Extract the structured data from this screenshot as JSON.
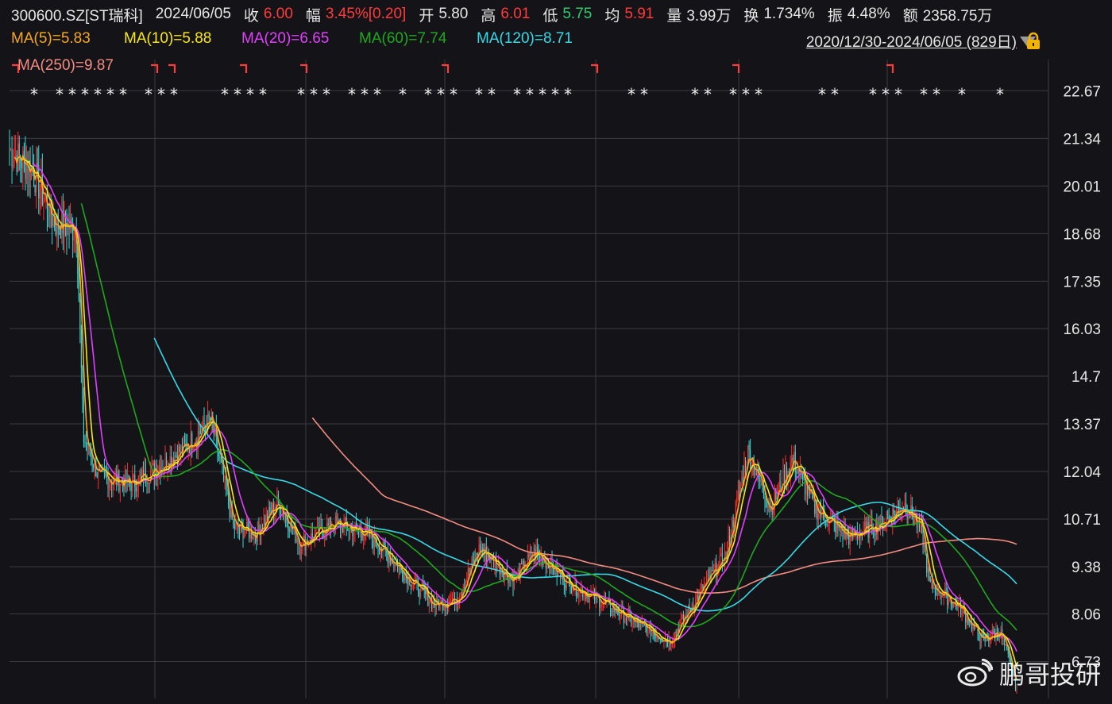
{
  "header": {
    "code": "300600.SZ[ST瑞科]",
    "date": "2024/06/05",
    "close_label": "收",
    "close_value": "6.00",
    "change_label": "幅",
    "change_value": "3.45%[0.20]",
    "open_label": "开",
    "open_value": "5.80",
    "high_label": "高",
    "high_value": "6.01",
    "low_label": "低",
    "low_value": "5.75",
    "avg_label": "均",
    "avg_value": "5.91",
    "volume_label": "量",
    "volume_value": "3.99万",
    "turnover_label": "换",
    "turnover_value": "1.734%",
    "amplitude_label": "振",
    "amplitude_value": "4.48%",
    "amount_label": "额",
    "amount_value": "2358.75万"
  },
  "ma_legend": {
    "ma5": "MA(5)=5.83",
    "ma10": "MA(10)=5.88",
    "ma20": "MA(20)=6.65",
    "ma60": "MA(60)=7.74",
    "ma120": "MA(120)=8.71",
    "ma250": "MA(250)=9.87",
    "range": "2020/12/30-2024/06/05 (829日)"
  },
  "colors": {
    "ma5": "#f5a623",
    "ma10": "#f8e71c",
    "ma20": "#e040fb",
    "ma60": "#1fa81f",
    "ma120": "#38d9e8",
    "ma250": "#f28b82",
    "up": "#ff2e2e",
    "down": "#3ad6d6",
    "grid": "#3a3a40"
  },
  "watermark": "鹏哥投研",
  "chart_data": {
    "type": "candlestick",
    "y_ticks": [
      "22.67",
      "21.34",
      "20.01",
      "18.68",
      "17.35",
      "16.03",
      "14.7",
      "13.37",
      "12.04",
      "10.71",
      "9.38",
      "8.06",
      "6.73"
    ],
    "ylim": [
      5.7,
      23.1
    ],
    "x_start": "2020/12/30",
    "x_end": "2024/06/05",
    "trading_days": 829,
    "approx_close_path": [
      [
        0,
        21.0
      ],
      [
        20,
        20.5
      ],
      [
        40,
        19.0
      ],
      [
        60,
        18.8
      ],
      [
        66,
        13.0
      ],
      [
        80,
        11.9
      ],
      [
        110,
        11.7
      ],
      [
        140,
        12.3
      ],
      [
        160,
        12.8
      ],
      [
        180,
        13.5
      ],
      [
        200,
        10.5
      ],
      [
        220,
        10.3
      ],
      [
        240,
        11.2
      ],
      [
        260,
        10.0
      ],
      [
        290,
        10.6
      ],
      [
        320,
        10.3
      ],
      [
        350,
        9.3
      ],
      [
        380,
        8.3
      ],
      [
        400,
        8.5
      ],
      [
        420,
        9.9
      ],
      [
        450,
        9.0
      ],
      [
        470,
        9.8
      ],
      [
        500,
        8.9
      ],
      [
        530,
        8.4
      ],
      [
        560,
        7.8
      ],
      [
        590,
        7.3
      ],
      [
        620,
        8.8
      ],
      [
        640,
        9.7
      ],
      [
        660,
        12.6
      ],
      [
        680,
        11.0
      ],
      [
        700,
        12.4
      ],
      [
        720,
        11.0
      ],
      [
        750,
        10.2
      ],
      [
        780,
        10.6
      ],
      [
        800,
        11.1
      ],
      [
        815,
        10.4
      ],
      [
        822,
        8.9
      ],
      [
        835,
        8.6
      ],
      [
        850,
        8.2
      ],
      [
        870,
        7.3
      ],
      [
        885,
        7.6
      ],
      [
        900,
        6.0
      ]
    ],
    "ma_series": [
      {
        "name": "MA(5)",
        "last": 5.83
      },
      {
        "name": "MA(10)",
        "last": 5.88
      },
      {
        "name": "MA(20)",
        "last": 6.65
      },
      {
        "name": "MA(60)",
        "last": 7.74
      },
      {
        "name": "MA(120)",
        "last": 8.71
      },
      {
        "name": "MA(250)",
        "last": 9.87
      }
    ],
    "grid": true
  }
}
